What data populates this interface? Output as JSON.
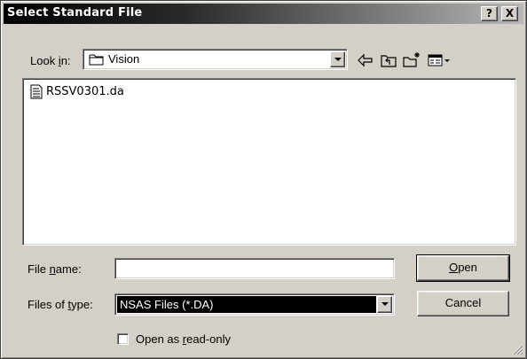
{
  "window": {
    "title": "Select Standard File",
    "help_label": "?",
    "close_label": "X"
  },
  "look_in": {
    "label_pre": "Look ",
    "label_accel": "i",
    "label_post": "n:",
    "value": "Vision"
  },
  "toolbar": {
    "icons": [
      "back-arrow-icon",
      "up-one-level-icon",
      "new-folder-icon",
      "view-menu-icon"
    ]
  },
  "files": [
    {
      "name": "RSSV0301.da",
      "icon": "text-file-icon"
    }
  ],
  "file_name": {
    "label_pre": "File ",
    "label_accel": "n",
    "label_post": "ame:",
    "value": ""
  },
  "file_type": {
    "label_pre": "Files of ",
    "label_accel": "t",
    "label_post": "ype:",
    "value": "NSAS Files (*.DA)"
  },
  "buttons": {
    "open_accel": "O",
    "open_rest": "pen",
    "cancel": "Cancel"
  },
  "read_only": {
    "label_pre": "Open as ",
    "label_accel": "r",
    "label_post": "ead-only",
    "checked": false
  },
  "colors": {
    "face": "#d4d0c8",
    "title_start": "#000000",
    "title_end": "#b8b8b8",
    "selection": "#000000"
  }
}
